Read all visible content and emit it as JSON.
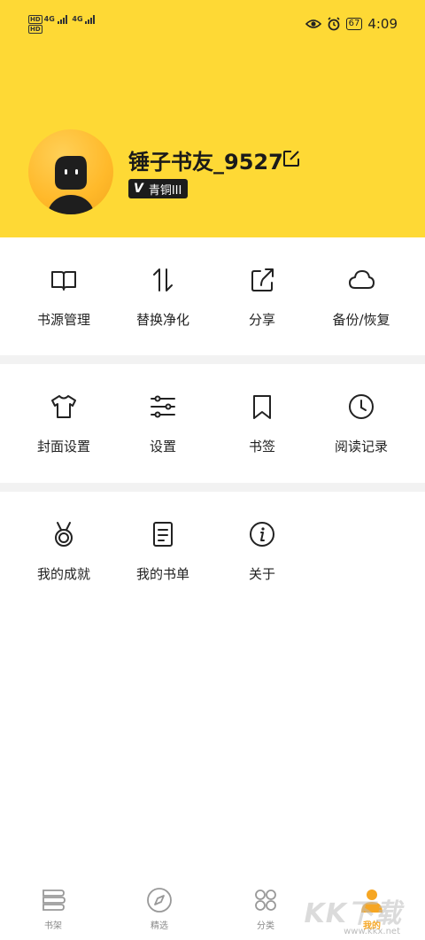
{
  "status_bar": {
    "left_line1": "4G",
    "left_line2": "4G",
    "hd_label": "HD",
    "battery": "67",
    "time": "4:09"
  },
  "profile": {
    "username": "锤子书友_9527",
    "badge_icon_text": "V",
    "badge_label": "青铜III"
  },
  "menu": {
    "row1": [
      {
        "label": "书源管理",
        "icon": "book-open-icon"
      },
      {
        "label": "替换净化",
        "icon": "swap-vertical-icon"
      },
      {
        "label": "分享",
        "icon": "share-icon"
      },
      {
        "label": "备份/恢复",
        "icon": "cloud-icon"
      }
    ],
    "row2": [
      {
        "label": "封面设置",
        "icon": "shirt-icon"
      },
      {
        "label": "设置",
        "icon": "sliders-icon"
      },
      {
        "label": "书签",
        "icon": "bookmark-icon"
      },
      {
        "label": "阅读记录",
        "icon": "clock-icon"
      }
    ],
    "row3": [
      {
        "label": "我的成就",
        "icon": "medal-icon"
      },
      {
        "label": "我的书单",
        "icon": "booklist-icon"
      },
      {
        "label": "关于",
        "icon": "info-icon"
      }
    ]
  },
  "tabbar": {
    "tabs": [
      {
        "label": "书架",
        "icon": "bookshelf-icon"
      },
      {
        "label": "精选",
        "icon": "compass-icon"
      },
      {
        "label": "分类",
        "icon": "category-icon"
      },
      {
        "label": "我的",
        "icon": "profile-icon"
      }
    ],
    "active_index": 3
  },
  "watermark": {
    "text": "KK下载",
    "sub": "www.kkx.net"
  },
  "colors": {
    "header_bg": "#fed935",
    "active_tab": "#f6a623",
    "badge_bg": "#1c1c1c"
  }
}
